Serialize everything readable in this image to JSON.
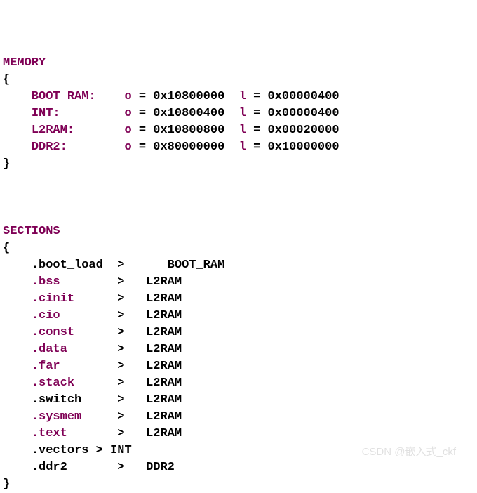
{
  "memory_block": {
    "header": "MEMORY",
    "open": "{",
    "close": "}",
    "rows": [
      {
        "name": "BOOT_RAM:",
        "o_kw": "o",
        "o_eq": " = ",
        "o_val": "0x10800000",
        "l_kw": "l",
        "l_eq": " = ",
        "l_val": "0x00000400"
      },
      {
        "name": "INT:",
        "o_kw": "o",
        "o_eq": " = ",
        "o_val": "0x10800400",
        "l_kw": "l",
        "l_eq": " = ",
        "l_val": "0x00000400"
      },
      {
        "name": "L2RAM:",
        "o_kw": "o",
        "o_eq": " = ",
        "o_val": "0x10800800",
        "l_kw": "l",
        "l_eq": " = ",
        "l_val": "0x00020000"
      },
      {
        "name": "DDR2:",
        "o_kw": "o",
        "o_eq": " = ",
        "o_val": "0x80000000",
        "l_kw": "l",
        "l_eq": " = ",
        "l_val": "0x10000000"
      }
    ]
  },
  "sections_block": {
    "header": "SECTIONS",
    "open": "{",
    "close": "}",
    "rows": [
      {
        "name": ".boot_load",
        "op": ">",
        "target": "BOOT_RAM",
        "name_kw": false,
        "target_indent_extra": true
      },
      {
        "name": ".bss",
        "op": ">",
        "target": "L2RAM",
        "name_kw": true
      },
      {
        "name": ".cinit",
        "op": ">",
        "target": "L2RAM",
        "name_kw": true
      },
      {
        "name": ".cio",
        "op": ">",
        "target": "L2RAM",
        "name_kw": true
      },
      {
        "name": ".const",
        "op": ">",
        "target": "L2RAM",
        "name_kw": true
      },
      {
        "name": ".data",
        "op": ">",
        "target": "L2RAM",
        "name_kw": true
      },
      {
        "name": ".far",
        "op": ">",
        "target": "L2RAM",
        "name_kw": true
      },
      {
        "name": ".stack",
        "op": ">",
        "target": "L2RAM",
        "name_kw": true
      },
      {
        "name": ".switch",
        "op": ">",
        "target": "L2RAM",
        "name_kw": false
      },
      {
        "name": ".sysmem",
        "op": ">",
        "target": "L2RAM",
        "name_kw": true
      },
      {
        "name": ".text",
        "op": ">",
        "target": "L2RAM",
        "name_kw": true
      },
      {
        "name": ".vectors",
        "op": ">",
        "target": "INT",
        "name_kw": false,
        "inline": true
      },
      {
        "name": ".ddr2",
        "op": ">",
        "target": "DDR2",
        "name_kw": false
      }
    ]
  },
  "watermark": "CSDN @嵌入式_ckf"
}
